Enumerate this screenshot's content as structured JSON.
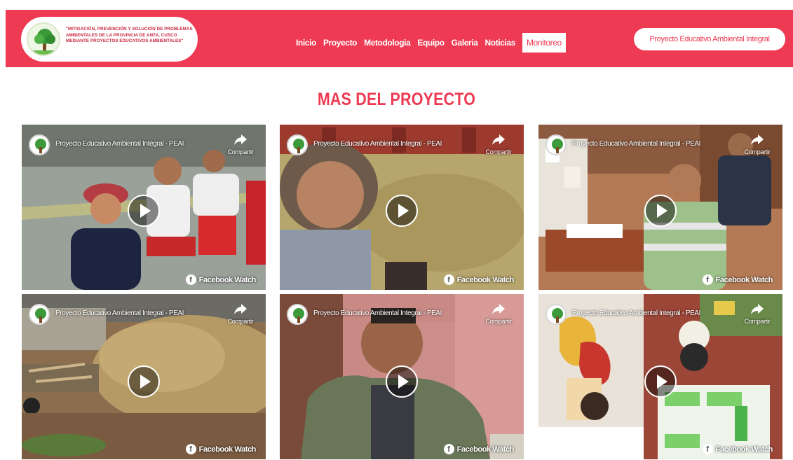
{
  "header": {
    "logo_text": "\"MITIGACIÓN, PREVENCIÓN Y SOLUCIÓN DE PROBLEMAS AMBIENTALES DE LA PROVINCIA DE ANTA, CUSCO MEDIANTE PROYECTOS EDUCATIVOS AMBIENTALES\"",
    "brand_pill": "Proyecto Educativo Ambiental Integral",
    "colors": {
      "primary": "#ee3a52",
      "white": "#ffffff"
    }
  },
  "nav": {
    "items": [
      "Inicio",
      "Proyecto",
      "Metodologia",
      "Equipo",
      "Galeria",
      "Noticias",
      "Monitoreo"
    ],
    "active": "Monitoreo"
  },
  "section": {
    "title": "MAS DEL PROYECTO"
  },
  "videos": [
    {
      "page_name": "Proyecto Educativo Ambiental Integral - PEAI",
      "share_label": "Compartir",
      "watch_label": "Facebook Watch"
    },
    {
      "page_name": "Proyecto Educativo Ambiental Integral - PEAI",
      "share_label": "Compartir",
      "watch_label": "Facebook Watch"
    },
    {
      "page_name": "Proyecto Educativo Ambiental Integral - PEAI",
      "share_label": "Compartir",
      "watch_label": "Facebook Watch"
    },
    {
      "page_name": "Proyecto Educativo Ambiental Integral - PEAI",
      "share_label": "Compartir",
      "watch_label": "Facebook Watch"
    },
    {
      "page_name": "Proyecto Educativo Ambiental Integral - PEAI",
      "share_label": "Compartir",
      "watch_label": "Facebook Watch"
    },
    {
      "page_name": "Proyecto Educativo Ambiental Integral - PEAI",
      "share_label": "Compartir",
      "watch_label": "Facebook Watch"
    }
  ],
  "icons": {
    "logo": "tree-logo-icon",
    "avatar": "tree-avatar-icon",
    "share": "share-arrow-icon",
    "play": "play-icon",
    "facebook": "facebook-icon"
  }
}
